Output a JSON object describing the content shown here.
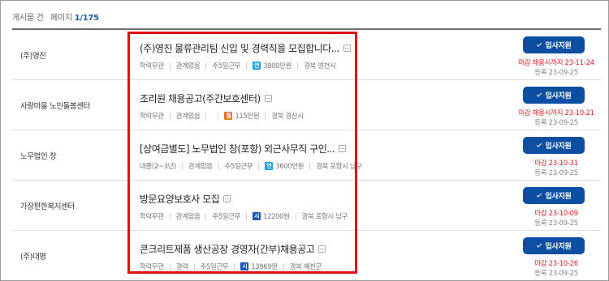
{
  "summary": {
    "prefix": "게시물 건",
    "page_label": "페이지",
    "page_value": "1/175"
  },
  "colors": {
    "accent": "#0b4ea2",
    "deadline": "#e2202a",
    "highlight": "#e01010"
  },
  "apply_label": "입사지원",
  "rows": [
    {
      "company": "(주)영진",
      "title": "(주)영진 물류관리팀 신입 및 경력직을 모집합니다...",
      "education": "학력무관",
      "experience": "관계없음",
      "workdays": "주5일근무",
      "pay_badge": "연",
      "pay_badge_color": "#1da1e0",
      "pay": "3800만원",
      "location": "경북 영천시",
      "deadline": "마감 채용시까지 23-11-24",
      "registered": "등록 23-09-25"
    },
    {
      "company": "사랑마을 노인돌봄센터",
      "title": "조리원 채용공고(주간보호센터)",
      "education": "학력무관",
      "experience": "관계없음",
      "workdays": "",
      "pay_badge": "월",
      "pay_badge_color": "#e8731e",
      "pay": "115만원",
      "location": "경북 경산시",
      "deadline": "마감 채용시까지 23-10-21",
      "registered": "등록 23-09-25"
    },
    {
      "company": "노무법인 창",
      "title": "[상여금별도] 노무법인 창(포항) 외근사무직 구인...",
      "education": "대졸(2~3년)",
      "experience": "관계없음",
      "workdays": "주5일근무",
      "pay_badge": "연",
      "pay_badge_color": "#1da1e0",
      "pay": "3600만원",
      "location": "경북 포항시 남구",
      "deadline": "마감 23-10-31",
      "registered": "등록 23-09-25"
    },
    {
      "company": "가장편한복지센터",
      "title": "방문요양보호사 모집",
      "education": "학력무관",
      "experience": "관계없음",
      "workdays": "주5일근무",
      "pay_badge": "시",
      "pay_badge_color": "#1a55b5",
      "pay": "12200원",
      "location": "경북 포항시 남구",
      "deadline": "마감 23-10-09",
      "registered": "등록 23-09-25"
    },
    {
      "company": "(주)대명",
      "title": "콘크리트제품 생산공장 경영자(간부)채용공고",
      "education": "학력무관",
      "experience": "경력",
      "workdays": "주5일근무",
      "pay_badge": "시",
      "pay_badge_color": "#1a55b5",
      "pay": "13969원",
      "location": "경북 예천군",
      "deadline": "마감 23-10-26",
      "registered": "등록 23-09-25"
    }
  ]
}
